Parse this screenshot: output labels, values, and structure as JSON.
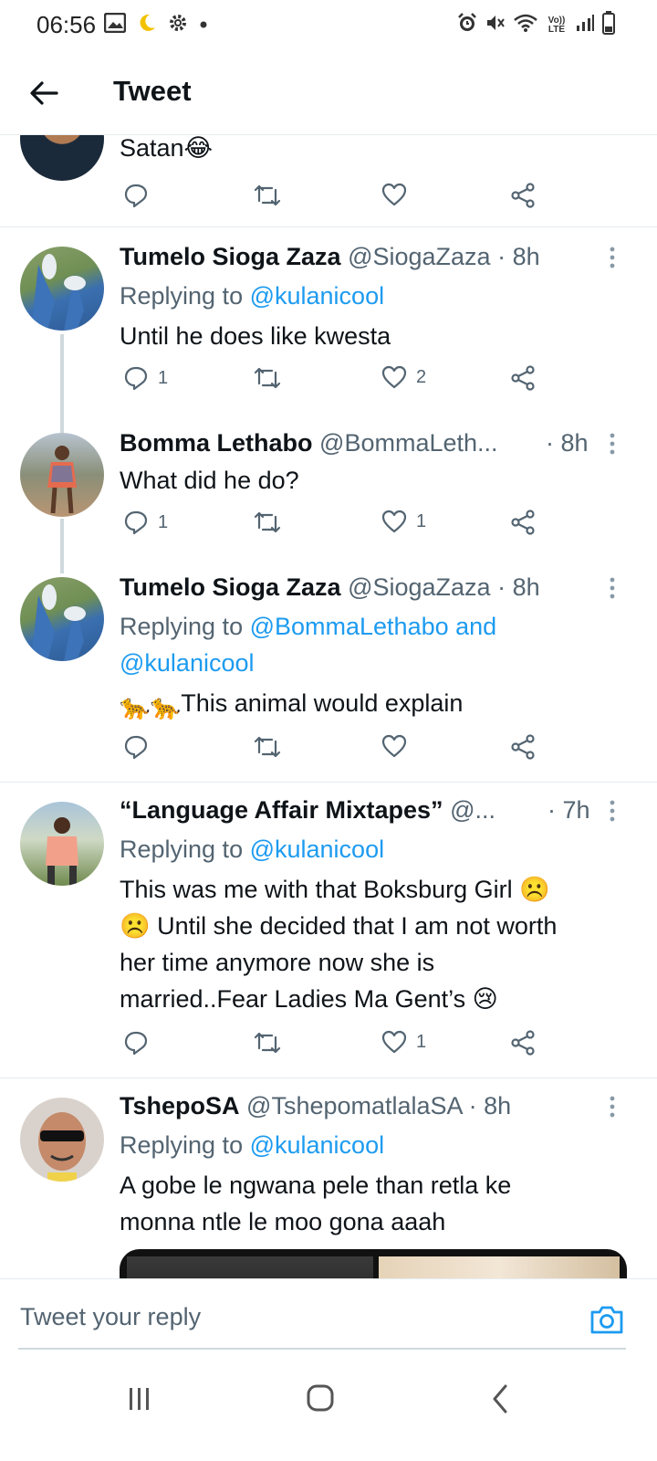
{
  "status_bar": {
    "time": "06:56",
    "left_icons": [
      "image-icon",
      "moon-icon",
      "gear-icon",
      "dot-icon"
    ],
    "right_icons": [
      "alarm-icon",
      "mute-icon",
      "wifi-icon",
      "volte-icon",
      "signal-icon",
      "battery-icon"
    ],
    "volte_label": "Vo)) LTE"
  },
  "header": {
    "title": "Tweet"
  },
  "tweets": [
    {
      "text": "Satan😂"
    },
    {
      "name": "Tumelo Sioga Zaza",
      "handle": "@SiogaZaza",
      "time": "· 8h",
      "replying_prefix": "Replying to ",
      "replying_to": "@kulanicool",
      "text": "Until he does like kwesta",
      "reply_count": "1",
      "like_count": "2"
    },
    {
      "name": "Bomma Lethabo",
      "handle": "@BommaLeth...",
      "time": "· 8h",
      "text": "What did he do?",
      "reply_count": "1",
      "like_count": "1"
    },
    {
      "name": "Tumelo Sioga Zaza",
      "handle": "@SiogaZaza",
      "time": "· 8h",
      "replying_prefix": "Replying to ",
      "replying_to": "@BommaLethabo and",
      "replying_to_2": "@kulanicool",
      "text_emoji": "🐆🐆",
      "text": "This animal would explain"
    },
    {
      "name": "“Language Affair Mixtapes”",
      "handle": "@...",
      "time": "· 7h",
      "replying_prefix": "Replying to ",
      "replying_to": "@kulanicool",
      "text_lines": [
        "This was me with that Boksburg Girl ☹️",
        "☹️ Until she decided that I am not worth",
        "her time anymore now she is",
        "married..Fear Ladies Ma Gent’s 😢"
      ],
      "like_count": "1"
    },
    {
      "name": "TshepoSA",
      "handle": "@TshepomatlalaSA",
      "time": "· 8h",
      "replying_prefix": "Replying to ",
      "replying_to": "@kulanicool",
      "text_lines": [
        "A gobe le ngwana pele than retla ke",
        "monna ntle le moo gona aaah"
      ]
    }
  ],
  "composer": {
    "placeholder": "Tweet your reply"
  },
  "colors": {
    "link": "#1d9bf0",
    "secondary_text": "#536471",
    "divider": "#e6ecf0",
    "thread_line": "#cfd9de"
  }
}
